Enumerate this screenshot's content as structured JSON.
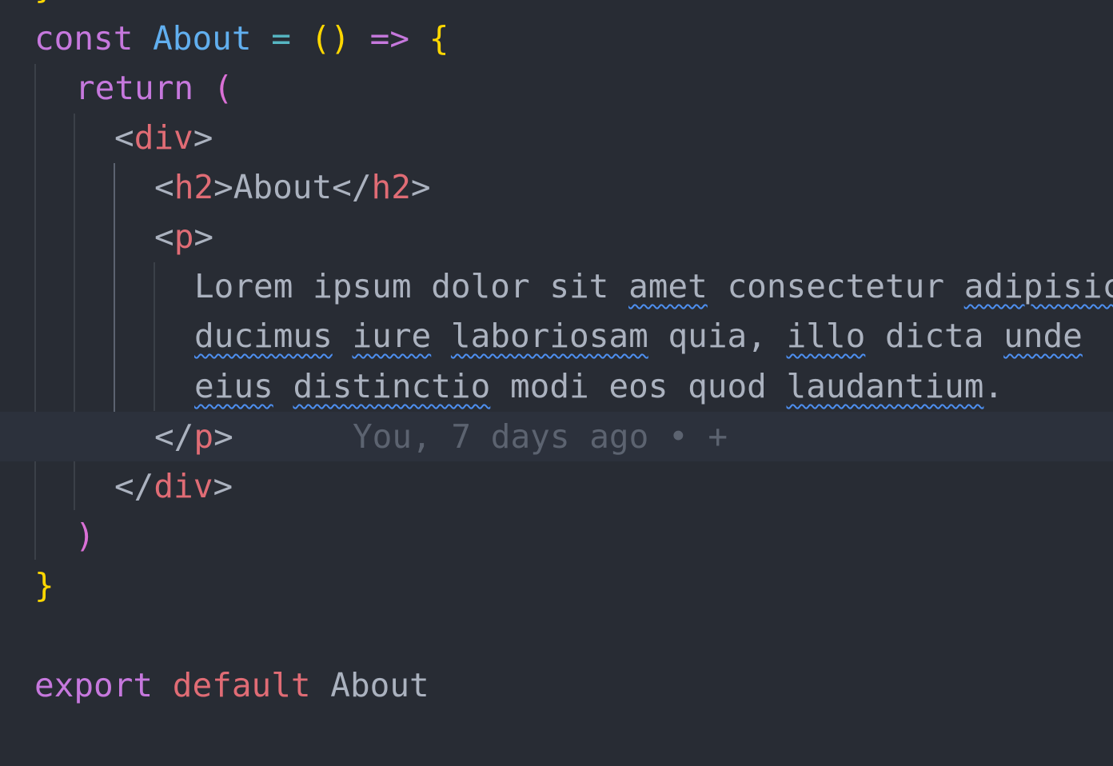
{
  "editor": {
    "colors": {
      "background": "#282c34",
      "keyword": "#c678dd",
      "function": "#61afef",
      "operator": "#56b6c2",
      "bracket": "#ffd700",
      "bracket2": "#da70d6",
      "tag": "#e06c75",
      "text": "#abb2bf",
      "blame": "#5c6370",
      "spellcheck": "#4d8ff0"
    },
    "top_partial_char": "}",
    "line1": {
      "kw": "const",
      "name": "About",
      "eq": "=",
      "parens": "()",
      "arrow": "=>",
      "brace": "{"
    },
    "line2": {
      "kw": "return",
      "paren": "("
    },
    "line3": {
      "open": "<",
      "tag": "div",
      "close": ">"
    },
    "line4": {
      "open": "<",
      "tag": "h2",
      "close": ">",
      "text": "About",
      "open2": "</",
      "tag2": "h2",
      "close2": ">"
    },
    "line5": {
      "open": "<",
      "tag": "p",
      "close": ">"
    },
    "line6": {
      "w1": "Lorem ipsum dolor sit ",
      "w2": "amet",
      "w3": " consectetur ",
      "w4": "adipisicing"
    },
    "line7": {
      "w1": "ducimus",
      "w2": " ",
      "w3": "iure",
      "w4": " ",
      "w5": "laboriosam",
      "w6": " quia, ",
      "w7": "illo",
      "w8": " dicta ",
      "w9": "unde",
      "w10": " "
    },
    "line8": {
      "w1": "eius",
      "w2": " ",
      "w3": "distinctio",
      "w4": " modi eos quod ",
      "w5": "laudantium",
      "w6": "."
    },
    "line9": {
      "open": "</",
      "tag": "p",
      "close": ">",
      "blame": "You, 7 days ago • +"
    },
    "line10": {
      "open": "</",
      "tag": "div",
      "close": ">"
    },
    "line11": {
      "paren": ")"
    },
    "line12": {
      "brace": "}"
    },
    "line14": {
      "kw": "export",
      "def": "default",
      "name": "About"
    }
  }
}
